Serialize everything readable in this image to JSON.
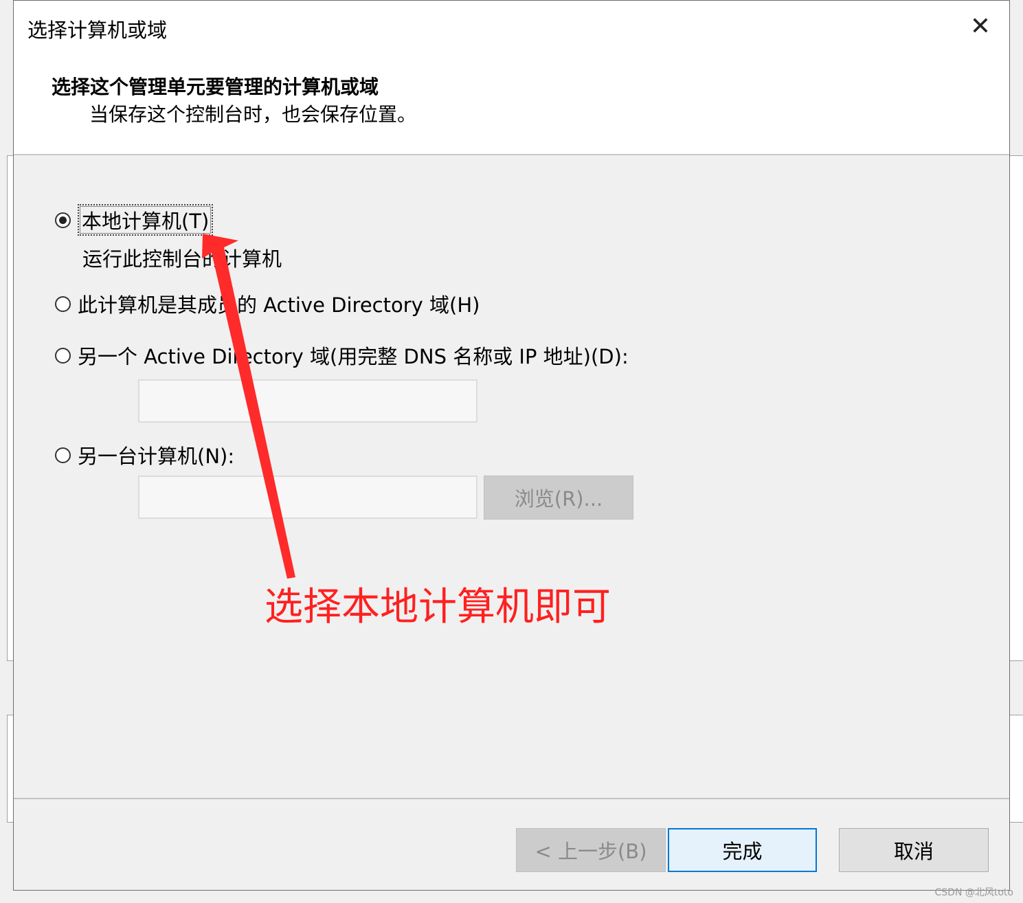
{
  "dialog": {
    "title": "选择计算机或域",
    "header_title": "选择这个管理单元要管理的计算机或域",
    "header_subtitle": "当保存这个控制台时，也会保存位置。",
    "options": [
      {
        "label": "本地计算机(T)",
        "checked": true
      },
      {
        "label": "此计算机是其成员的 Active Directory 域(H)",
        "checked": false
      },
      {
        "label": "另一个 Active Directory 域(用完整 DNS 名称或 IP 地址)(D):",
        "checked": false
      },
      {
        "label": "另一台计算机(N):",
        "checked": false
      }
    ],
    "local_description": "运行此控制台的计算机",
    "domain_input_value": "",
    "computer_input_value": "",
    "browse_label": "浏览(R)...",
    "back_label": "< 上一步(B)",
    "finish_label": "完成",
    "cancel_label": "取消"
  },
  "annotation": {
    "text": "选择本地计算机即可",
    "color": "#ff2020"
  },
  "watermark": "CSDN @北风toto"
}
